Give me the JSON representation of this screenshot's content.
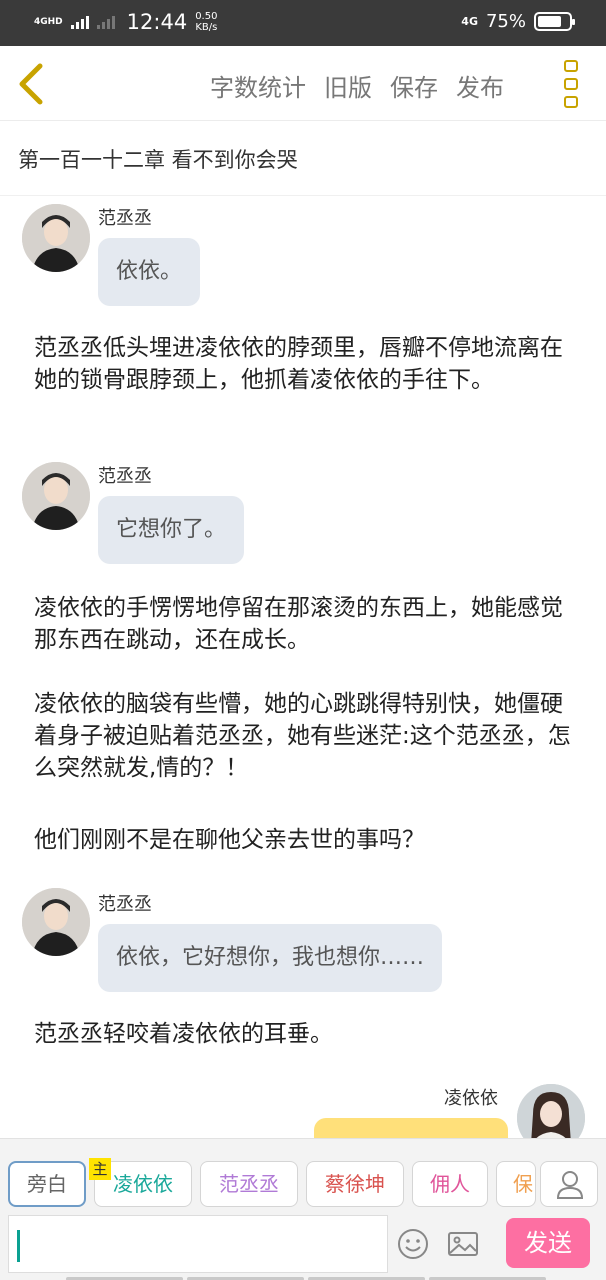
{
  "status_bar": {
    "network_left": "4GHD",
    "time": "12:44",
    "speed_value": "0.50",
    "speed_unit": "KB/s",
    "network_right": "4G",
    "battery_percent": "75%",
    "battery_level": 0.75
  },
  "header": {
    "actions": [
      "字数统计",
      "旧版",
      "保存",
      "发布"
    ],
    "accent_color": "#c8a300"
  },
  "chapter_title": "第一百一十二章  看不到你会哭",
  "messages": [
    {
      "speaker": "范丞丞",
      "text": "依依。"
    },
    {
      "narration": "范丞丞低头埋进凌依依的脖颈里，唇瓣不停地流离在她的锁骨跟脖颈上，他抓着凌依依的手往下。"
    },
    {
      "speaker": "范丞丞",
      "text": "它想你了。"
    },
    {
      "narration": "凌依依的手愣愣地停留在那滚烫的东西上，她能感觉那东西在跳动，还在成长。"
    },
    {
      "narration": "凌依依的脑袋有些懵，她的心跳跳得特别快，她僵硬着身子被迫贴着范丞丞，她有些迷茫:这个范丞丞，怎么突然就发,情的？！"
    },
    {
      "narration": "他们刚刚不是在聊他父亲去世的事吗？"
    },
    {
      "speaker": "范丞丞",
      "text": "依依，它好想你，我也想你……"
    },
    {
      "narration": "范丞丞轻咬着凌依依的耳垂。"
    },
    {
      "speaker": "凌依依",
      "text": ""
    }
  ],
  "roles": [
    {
      "label": "旁白",
      "color": "#666666",
      "tag": ""
    },
    {
      "label": "凌依依",
      "color": "#1aa89a",
      "tag": "主"
    },
    {
      "label": "范丞丞",
      "color": "#b07ad6",
      "tag": ""
    },
    {
      "label": "蔡徐坤",
      "color": "#d9534f",
      "tag": ""
    },
    {
      "label": "佣人",
      "color": "#e0559a",
      "tag": ""
    },
    {
      "label": "保",
      "color": "#f0a050",
      "tag": ""
    }
  ],
  "composer": {
    "input_value": "",
    "send_label": "发送",
    "send_color": "#fd6fa2"
  }
}
